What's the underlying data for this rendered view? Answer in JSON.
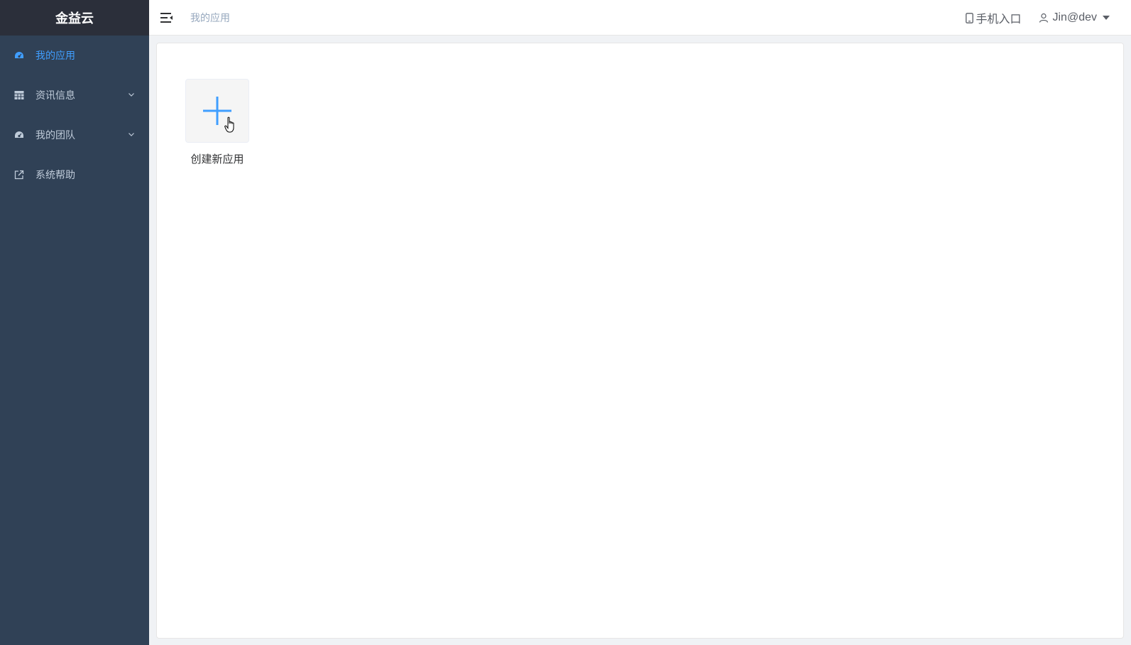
{
  "app": {
    "title": "金益云"
  },
  "sidebar": {
    "items": [
      {
        "label": "我的应用",
        "icon": "dashboard-icon",
        "active": true,
        "expandable": false
      },
      {
        "label": "资讯信息",
        "icon": "table-grid-icon",
        "active": false,
        "expandable": true
      },
      {
        "label": "我的团队",
        "icon": "dashboard-icon",
        "active": false,
        "expandable": true
      },
      {
        "label": "系统帮助",
        "icon": "external-link-icon",
        "active": false,
        "expandable": false
      }
    ]
  },
  "navbar": {
    "hamburger_icon": "hamburger-icon",
    "breadcrumb": "我的应用",
    "mobile_entry": "手机入口",
    "mobile_icon": "mobile-phone-icon",
    "user": "Jin@dev",
    "user_icon": "user-icon",
    "dropdown_icon": "caret-down-icon"
  },
  "main": {
    "create_app_label": "创建新应用",
    "create_icon": "plus-icon"
  },
  "colors": {
    "sidebar_bg": "#304156",
    "logo_bg": "#2b2f3a",
    "accent": "#409eff",
    "sidebar_text": "#bfcbd9",
    "breadcrumb_text": "#97a8be"
  }
}
